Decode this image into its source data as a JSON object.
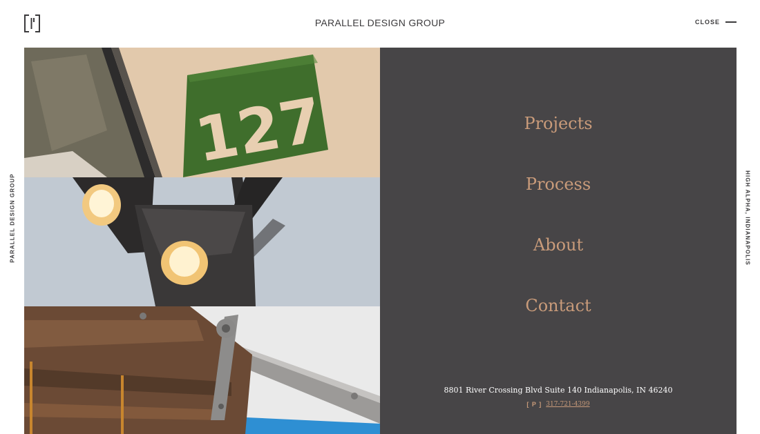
{
  "header": {
    "title": "PARALLEL DESIGN GROUP",
    "close_label": "CLOSE",
    "logo_icon": "p-bracket-logo-icon"
  },
  "side": {
    "left_text": "PARALLEL DESIGN GROUP",
    "right_text": "HIGH ALPHA, INDIANAPOLIS"
  },
  "photos": [
    {
      "icon": "green-127-sign-photo",
      "text": "127"
    },
    {
      "icon": "pendant-lamps-photo"
    },
    {
      "icon": "barn-door-hardware-photo"
    }
  ],
  "menu": {
    "items": [
      {
        "label": "Projects"
      },
      {
        "label": "Process"
      },
      {
        "label": "About"
      },
      {
        "label": "Contact"
      }
    ]
  },
  "footer": {
    "address": "8801 River Crossing Blvd Suite 140 Indianapolis, IN 46240",
    "phone_icon_text": "[ P ]",
    "phone": "317-721-4399"
  },
  "colors": {
    "accent": "#c99b7a",
    "panel": "#474547",
    "text": "#3b3a3c"
  }
}
